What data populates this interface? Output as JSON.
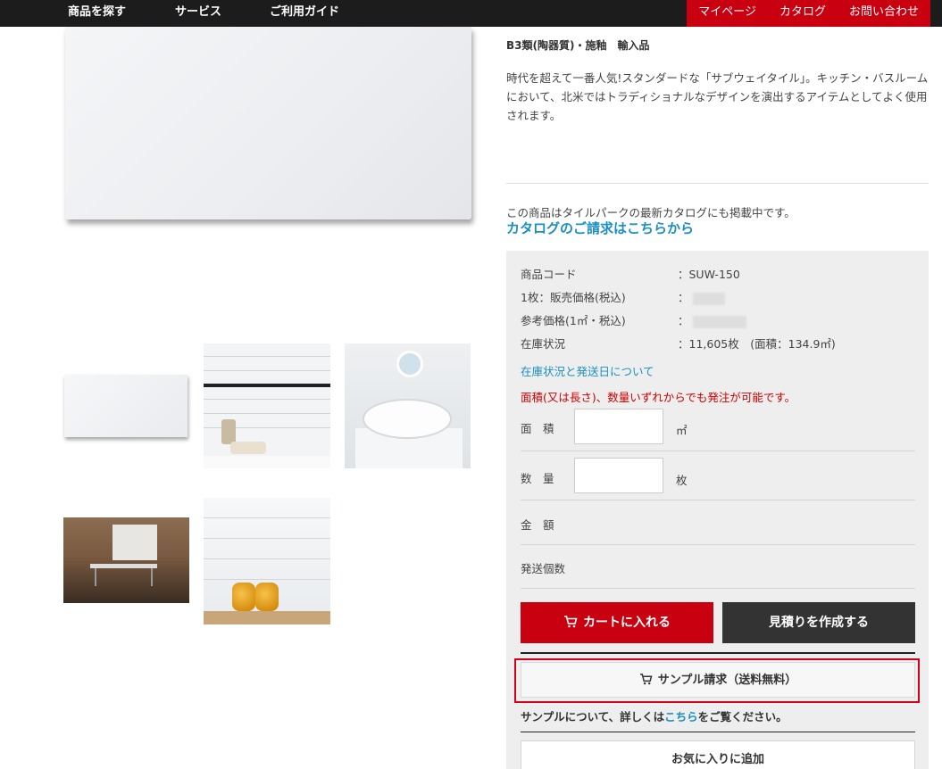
{
  "nav": {
    "left": [
      "商品を探す",
      "サービス",
      "ご利用ガイド"
    ],
    "right": [
      "マイページ",
      "カタログ",
      "お問い合わせ"
    ]
  },
  "product": {
    "spec_line": "B3類(陶器質)・施釉　輸入品",
    "description": "時代を超えて一番人気!スタンダードな「サブウェイタイル」。キッチン・バスルームにおいて、北米ではトラディショナルなデザインを演出するアイテムとしてよく使用されます。",
    "catalog_note": "この商品はタイルパークの最新カタログにも掲載中です。",
    "catalog_link": "カタログのご請求はこちらから"
  },
  "info": {
    "rows": [
      {
        "label": "商品コード",
        "value": "：SUW-150"
      },
      {
        "label": "1枚：販売価格(税込)",
        "value": "："
      },
      {
        "label": "参考価格(1㎡・税込)",
        "value": "："
      },
      {
        "label": "在庫状況",
        "value": "：11,605枚　(面積：134.9㎡)"
      }
    ],
    "stock_link": "在庫状況と発送日について",
    "order_note": "面積(又は長さ)、数量いずれからでも発注が可能です。",
    "area_label": "面　積",
    "area_unit": "㎡",
    "qty_label": "数　量",
    "qty_unit": "枚",
    "amount_label": "金　額",
    "shipping_label": "発送個数"
  },
  "buttons": {
    "cart": "カートに入れる",
    "quote": "見積りを作成する",
    "sample": "サンプル請求（送料無料）",
    "favorite": "お気に入りに追加"
  },
  "sample_note": {
    "before": "サンプルについて、詳しくは",
    "link": "こちら",
    "after": "をご覧ください。"
  },
  "colors": {
    "accent_red": "#c9000f",
    "link_blue": "#1a8fc0",
    "dark": "#333333"
  },
  "icons": [
    "cart-icon"
  ]
}
